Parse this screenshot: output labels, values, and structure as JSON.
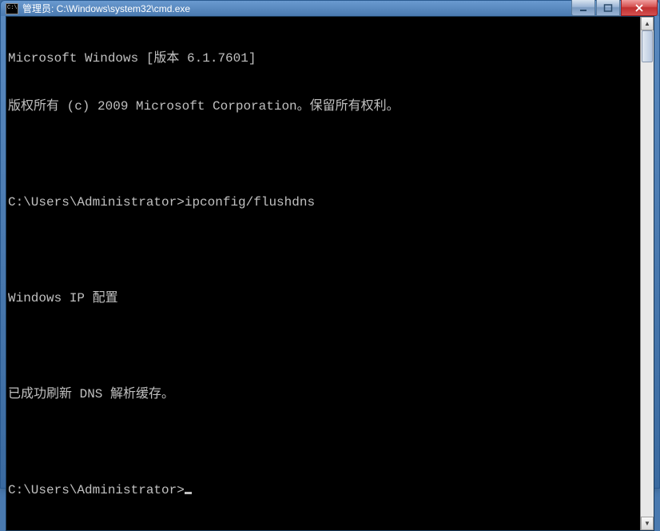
{
  "window": {
    "title": "管理员: C:\\Windows\\system32\\cmd.exe"
  },
  "terminal": {
    "lines": [
      "Microsoft Windows [版本 6.1.7601]",
      "版权所有 (c) 2009 Microsoft Corporation。保留所有权利。",
      "",
      "C:\\Users\\Administrator>ipconfig/flushdns",
      "",
      "Windows IP 配置",
      "",
      "已成功刷新 DNS 解析缓存。",
      "",
      "C:\\Users\\Administrator>"
    ]
  }
}
